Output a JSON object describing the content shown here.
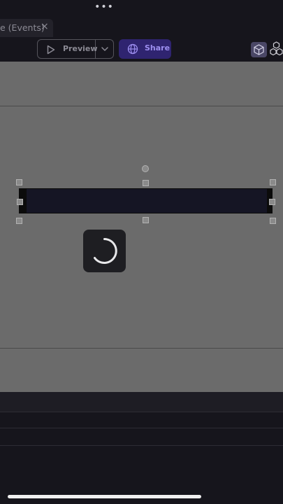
{
  "top": {
    "more_glyph": "•••"
  },
  "tab": {
    "label": "e (Events)",
    "close_glyph": "×"
  },
  "toolbar": {
    "preview_label": "Preview",
    "share_label": "Share",
    "icons": [
      "play-icon",
      "chevron-down-icon",
      "globe-icon",
      "cube-icon",
      "cubes-icon"
    ]
  },
  "colors": {
    "canvas": "#6b6b6b",
    "app_bg": "#16151c",
    "share_bg": "#2f2470",
    "share_text": "#9d8ff0"
  },
  "canvas": {
    "loading": true
  }
}
